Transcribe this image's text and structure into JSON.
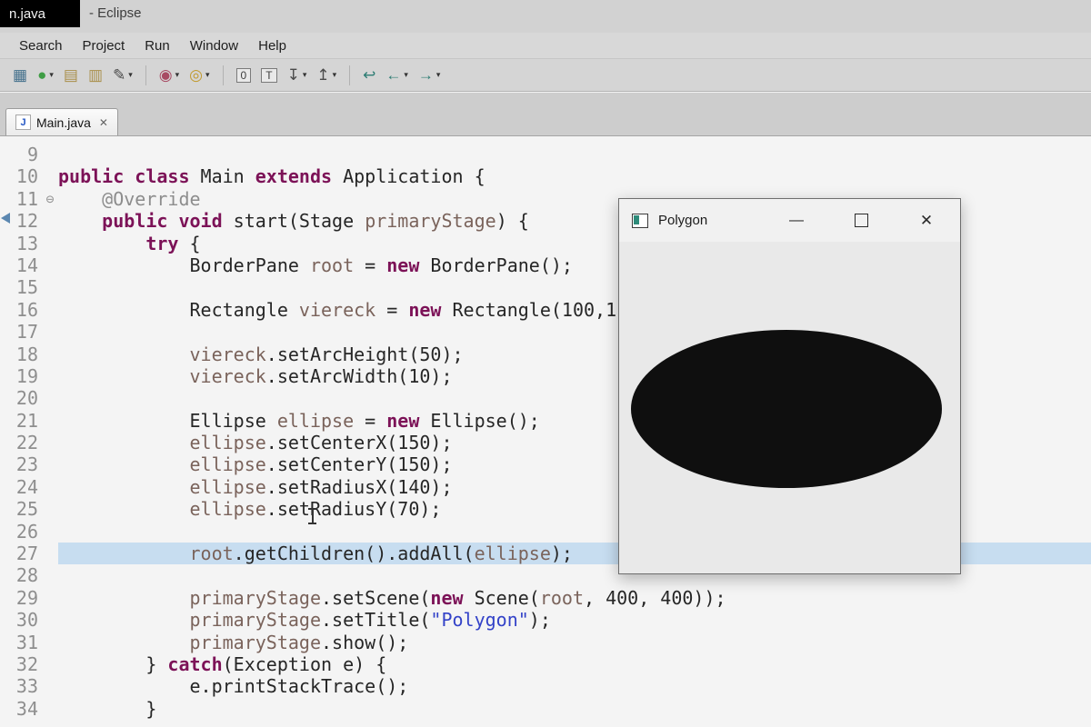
{
  "window": {
    "title_left": "n.java",
    "title_right": "- Eclipse"
  },
  "menu": {
    "items": [
      "Search",
      "Project",
      "Run",
      "Window",
      "Help"
    ]
  },
  "toolbar": {
    "items": [
      {
        "type": "btn",
        "name": "new-wizard-icon",
        "glyph": "▦",
        "color": "#44708c"
      },
      {
        "type": "btn",
        "name": "globe-icon",
        "glyph": "●",
        "color": "#3f9d45",
        "dropdown": true
      },
      {
        "type": "btn",
        "name": "save-icon",
        "glyph": "▤",
        "color": "#a98f4a"
      },
      {
        "type": "btn",
        "name": "package-icon",
        "glyph": "▥",
        "color": "#a98f4a"
      },
      {
        "type": "btn",
        "name": "pencil-icon",
        "glyph": "✎",
        "color": "#4a4a4a",
        "dropdown": true
      },
      {
        "type": "sep"
      },
      {
        "type": "btn",
        "name": "debug-icon",
        "glyph": "◉",
        "color": "#a84a63",
        "dropdown": true
      },
      {
        "type": "btn",
        "name": "run-icon",
        "glyph": "◎",
        "color": "#c19a2e",
        "dropdown": true
      },
      {
        "type": "sep"
      },
      {
        "type": "btn",
        "name": "box-0-icon",
        "glyph": "0",
        "box": true
      },
      {
        "type": "btn",
        "name": "box-t-icon",
        "glyph": "T",
        "box": true
      },
      {
        "type": "btn",
        "name": "next-annotation-icon",
        "glyph": "↧",
        "color": "#4a4a4a",
        "dropdown": true
      },
      {
        "type": "btn",
        "name": "prev-annotation-icon",
        "glyph": "↥",
        "color": "#4a4a4a",
        "dropdown": true
      },
      {
        "type": "sep"
      },
      {
        "type": "btn",
        "name": "last-edit-location-icon",
        "glyph": "↩",
        "color": "#2e7d74"
      },
      {
        "type": "btn",
        "name": "back-icon",
        "glyph": "←",
        "color": "#2e7d74",
        "dropdown": true
      },
      {
        "type": "btn",
        "name": "forward-icon",
        "glyph": "→",
        "color": "#2e7d74",
        "dropdown": true
      }
    ]
  },
  "editor": {
    "tab": {
      "label": "Main.java",
      "icon_letter": "J",
      "close_glyph": "✕"
    },
    "fold_glyph": "⊖",
    "highlight_line": "27",
    "lines": [
      {
        "n": "9",
        "tokens": []
      },
      {
        "n": "10",
        "tokens": [
          [
            "k",
            "public"
          ],
          [
            "p",
            " "
          ],
          [
            "k",
            "class"
          ],
          [
            "p",
            " Main "
          ],
          [
            "k",
            "extends"
          ],
          [
            "p",
            " Application {"
          ]
        ]
      },
      {
        "n": "11",
        "fold": true,
        "tokens": [
          [
            "a",
            "    @Override"
          ]
        ]
      },
      {
        "n": "12",
        "tokens": [
          [
            "p",
            "    "
          ],
          [
            "k",
            "public"
          ],
          [
            "p",
            " "
          ],
          [
            "k",
            "void"
          ],
          [
            "p",
            " start(Stage "
          ],
          [
            "v",
            "primaryStage"
          ],
          [
            "p",
            ") {"
          ]
        ]
      },
      {
        "n": "13",
        "tokens": [
          [
            "p",
            "        "
          ],
          [
            "k",
            "try"
          ],
          [
            "p",
            " {"
          ]
        ]
      },
      {
        "n": "14",
        "tokens": [
          [
            "p",
            "            BorderPane "
          ],
          [
            "v",
            "root"
          ],
          [
            "p",
            " = "
          ],
          [
            "k",
            "new"
          ],
          [
            "p",
            " BorderPane();"
          ]
        ]
      },
      {
        "n": "15",
        "tokens": []
      },
      {
        "n": "16",
        "tokens": [
          [
            "p",
            "            Rectangle "
          ],
          [
            "v",
            "viereck"
          ],
          [
            "p",
            " = "
          ],
          [
            "k",
            "new"
          ],
          [
            "p",
            " Rectangle(100,1"
          ]
        ]
      },
      {
        "n": "17",
        "tokens": []
      },
      {
        "n": "18",
        "tokens": [
          [
            "p",
            "            "
          ],
          [
            "v",
            "viereck"
          ],
          [
            "p",
            ".setArcHeight(50);"
          ]
        ]
      },
      {
        "n": "19",
        "tokens": [
          [
            "p",
            "            "
          ],
          [
            "v",
            "viereck"
          ],
          [
            "p",
            ".setArcWidth(10);"
          ]
        ]
      },
      {
        "n": "20",
        "tokens": []
      },
      {
        "n": "21",
        "tokens": [
          [
            "p",
            "            Ellipse "
          ],
          [
            "v",
            "ellipse"
          ],
          [
            "p",
            " = "
          ],
          [
            "k",
            "new"
          ],
          [
            "p",
            " Ellipse();"
          ]
        ]
      },
      {
        "n": "22",
        "tokens": [
          [
            "p",
            "            "
          ],
          [
            "v",
            "ellipse"
          ],
          [
            "p",
            ".setCenterX(150);"
          ]
        ]
      },
      {
        "n": "23",
        "tokens": [
          [
            "p",
            "            "
          ],
          [
            "v",
            "ellipse"
          ],
          [
            "p",
            ".setCenterY(150);"
          ]
        ]
      },
      {
        "n": "24",
        "tokens": [
          [
            "p",
            "            "
          ],
          [
            "v",
            "ellipse"
          ],
          [
            "p",
            ".setRadiusX(140);"
          ]
        ]
      },
      {
        "n": "25",
        "tokens": [
          [
            "p",
            "            "
          ],
          [
            "v",
            "ellipse"
          ],
          [
            "p",
            ".setRadiusY(70);"
          ]
        ]
      },
      {
        "n": "26",
        "tokens": []
      },
      {
        "n": "27",
        "hl": true,
        "tokens": [
          [
            "p",
            "            "
          ],
          [
            "v",
            "root"
          ],
          [
            "p",
            ".getChildren().addAll("
          ],
          [
            "v",
            "ellipse"
          ],
          [
            "p",
            ");"
          ]
        ]
      },
      {
        "n": "28",
        "tokens": []
      },
      {
        "n": "29",
        "tokens": [
          [
            "p",
            "            "
          ],
          [
            "v",
            "primaryStage"
          ],
          [
            "p",
            ".setScene("
          ],
          [
            "k",
            "new"
          ],
          [
            "p",
            " Scene("
          ],
          [
            "v",
            "root"
          ],
          [
            "p",
            ", 400, 400));"
          ]
        ]
      },
      {
        "n": "30",
        "tokens": [
          [
            "p",
            "            "
          ],
          [
            "v",
            "primaryStage"
          ],
          [
            "p",
            ".setTitle("
          ],
          [
            "s",
            "\"Polygon\""
          ],
          [
            "p",
            ");"
          ]
        ]
      },
      {
        "n": "31",
        "tokens": [
          [
            "p",
            "            "
          ],
          [
            "v",
            "primaryStage"
          ],
          [
            "p",
            ".show();"
          ]
        ]
      },
      {
        "n": "32",
        "tokens": [
          [
            "p",
            "        } "
          ],
          [
            "k",
            "catch"
          ],
          [
            "p",
            "(Exception e) {"
          ]
        ]
      },
      {
        "n": "33",
        "tokens": [
          [
            "p",
            "            e.printStackTrace();"
          ]
        ]
      },
      {
        "n": "34",
        "tokens": [
          [
            "p",
            "        }"
          ]
        ]
      }
    ]
  },
  "overlay_window": {
    "title": "Polygon",
    "minimize_glyph": "—",
    "close_glyph": "✕",
    "ellipse_color": "#0f0f0f"
  }
}
